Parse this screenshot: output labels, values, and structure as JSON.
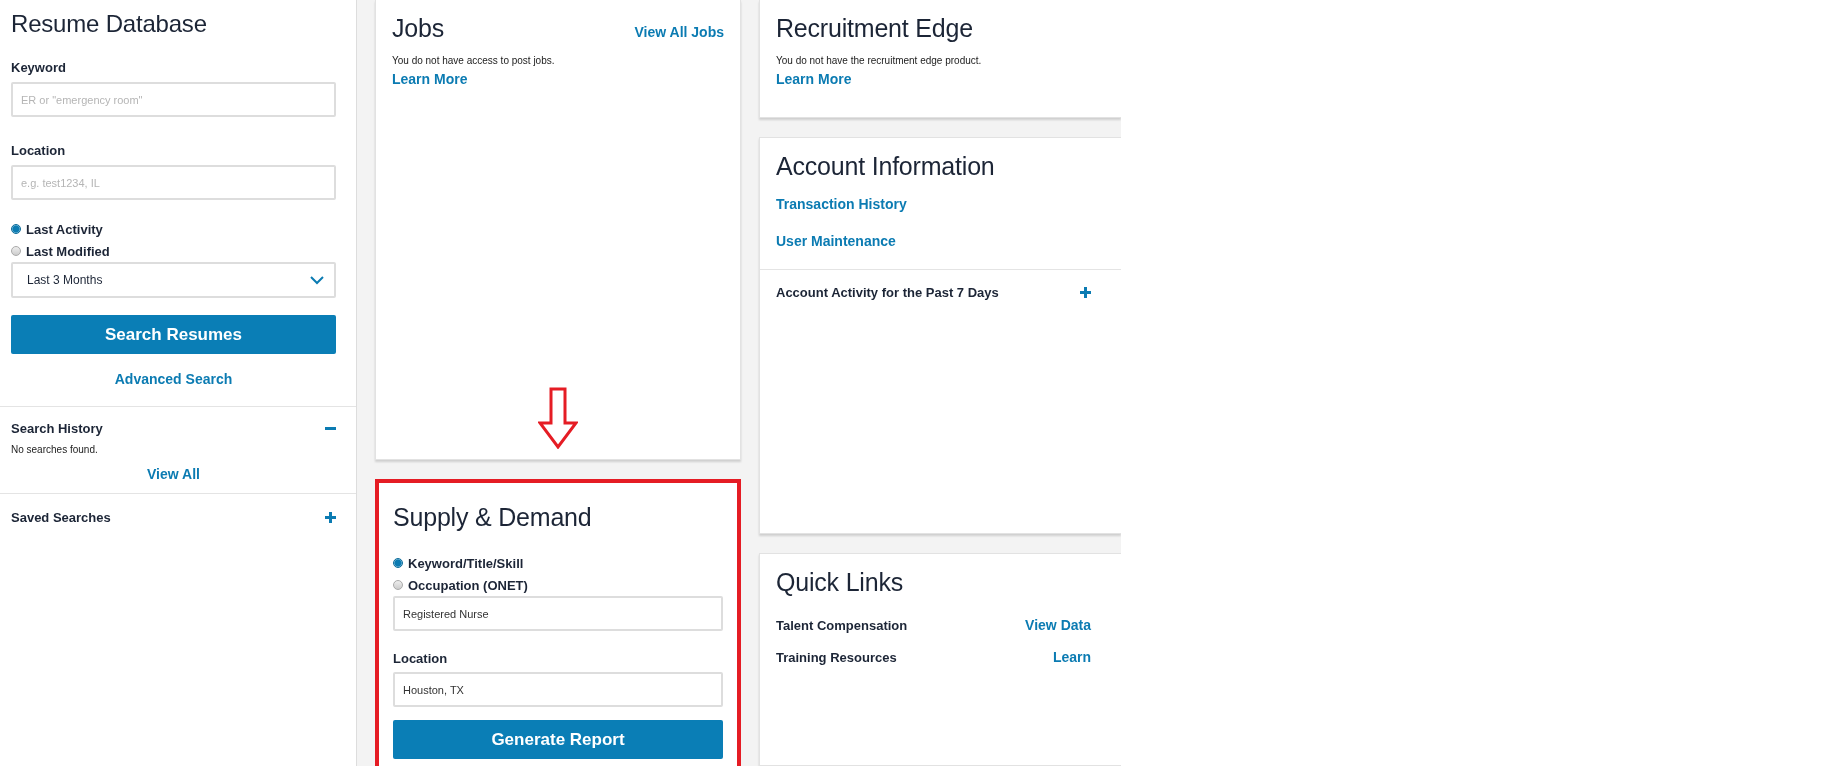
{
  "sidebar": {
    "title": "Resume Database",
    "keyword": {
      "label": "Keyword",
      "placeholder": "ER or \"emergency room\""
    },
    "location": {
      "label": "Location",
      "placeholder": "e.g. test1234, IL"
    },
    "date_options": [
      {
        "label": "Last Activity",
        "selected": true
      },
      {
        "label": "Last Modified",
        "selected": false
      }
    ],
    "range_select": {
      "value": "Last 3 Months"
    },
    "search_button": "Search Resumes",
    "advanced_link": "Advanced Search",
    "search_history": {
      "title": "Search History",
      "expanded": true,
      "empty_text": "No searches found.",
      "view_all": "View All"
    },
    "saved_searches": {
      "title": "Saved Searches",
      "expanded": false
    }
  },
  "jobs": {
    "title": "Jobs",
    "view_all": "View All Jobs",
    "message": "You do not have access to post jobs.",
    "learn_more": "Learn More"
  },
  "supply_demand": {
    "title": "Supply & Demand",
    "highlighted": true,
    "search_types": [
      {
        "label": "Keyword/Title/Skill",
        "selected": true
      },
      {
        "label": "Occupation (ONET)",
        "selected": false
      }
    ],
    "keyword_value": "Registered Nurse",
    "location_label": "Location",
    "location_value": "Houston, TX",
    "button": "Generate Report"
  },
  "recruitment_edge": {
    "title": "Recruitment Edge",
    "message": "You do not have the recruitment edge product.",
    "learn_more": "Learn More"
  },
  "account_information": {
    "title": "Account Information",
    "links": [
      "Transaction History",
      "User Maintenance"
    ],
    "activity": {
      "label": "Account Activity for the Past 7 Days",
      "expanded": false
    }
  },
  "quick_links": {
    "title": "Quick Links",
    "items": [
      {
        "label": "Talent Compensation",
        "link": "View Data"
      },
      {
        "label": "Training Resources",
        "link": "Learn"
      }
    ]
  }
}
